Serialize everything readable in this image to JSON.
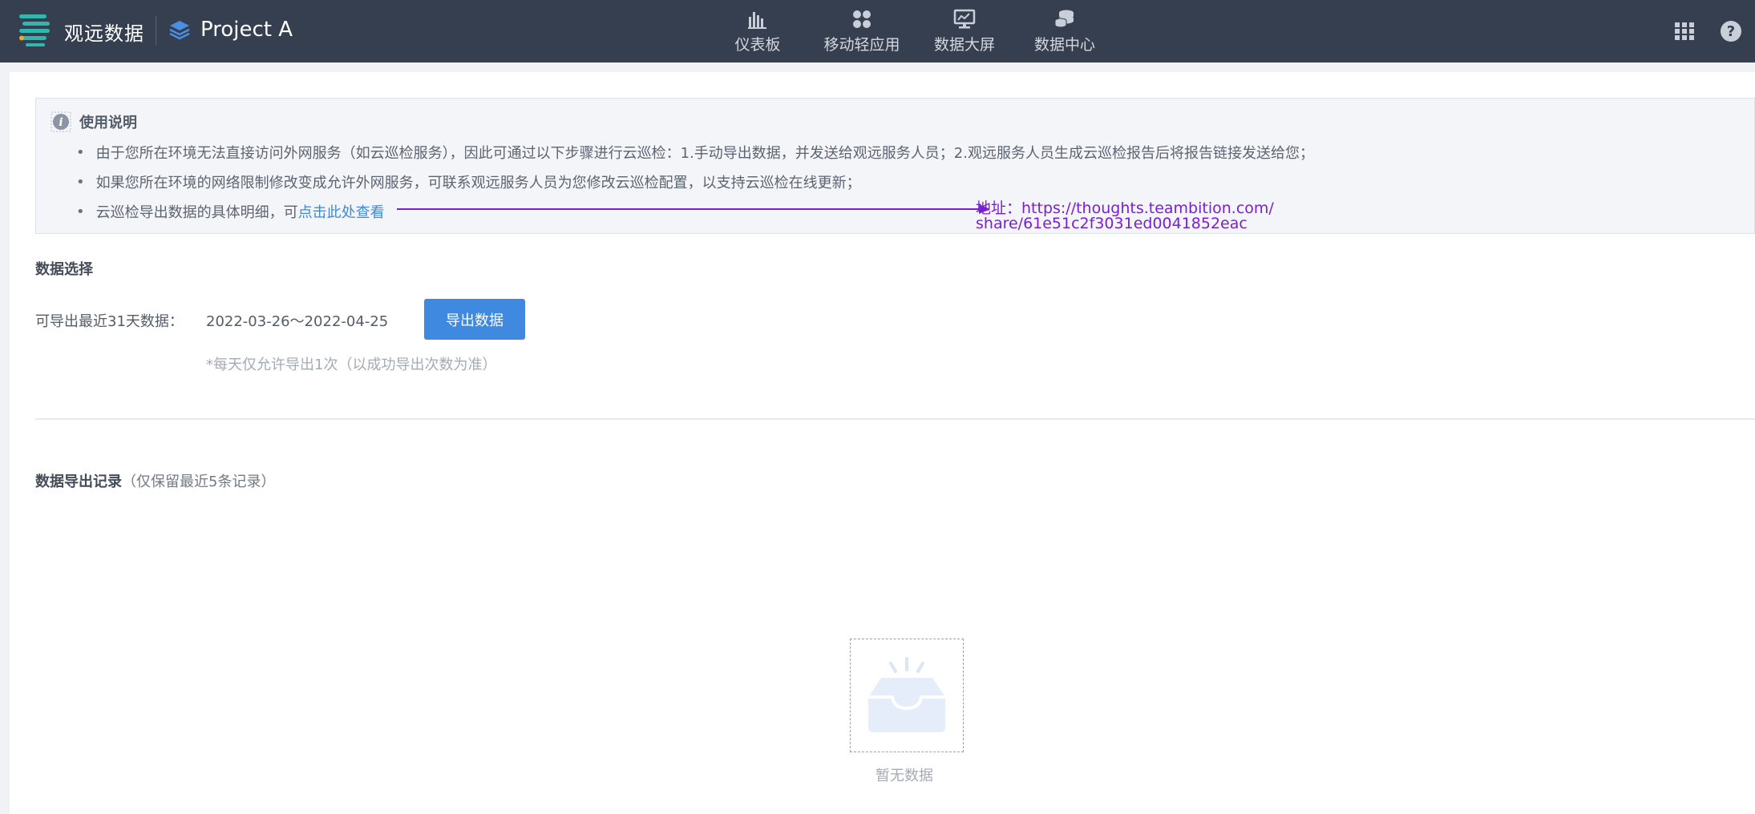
{
  "header": {
    "brand": "观远数据",
    "project": "Project A",
    "nav": [
      {
        "label": "仪表板",
        "icon": "bar-chart-icon"
      },
      {
        "label": "移动轻应用",
        "icon": "app-grid-icon"
      },
      {
        "label": "数据大屏",
        "icon": "monitor-icon"
      },
      {
        "label": "数据中心",
        "icon": "database-icon"
      }
    ],
    "right_icons": [
      "apps-icon",
      "help-icon"
    ]
  },
  "notice": {
    "title": "使用说明",
    "bullets": [
      "由于您所在环境无法直接访问外网服务（如云巡检服务），因此可通过以下步骤进行云巡检：1.手动导出数据，并发送给观远服务人员；2.观远服务人员生成云巡检报告后将报告链接发送给您；",
      "如果您所在环境的网络限制修改变成允许外网服务，可联系观远服务人员为您修改云巡检配置，以支持云巡检在线更新；",
      "云巡检导出数据的具体明细，可"
    ],
    "link_text": "点击此处查看",
    "annotation_line1": "地址：https://thoughts.teambition.com/",
    "annotation_line2": "share/61e51c2f3031ed0041852eac"
  },
  "data_select": {
    "title": "数据选择",
    "label": "可导出最近31天数据：",
    "range": "2022-03-26～2022-04-25",
    "button": "导出数据",
    "hint": "*每天仅允许导出1次（以成功导出次数为准）"
  },
  "records": {
    "title": "数据导出记录",
    "subtitle": "（仅保留最近5条记录）",
    "empty_text": "暂无数据"
  },
  "colors": {
    "topbar": "#353f4f",
    "primary": "#3f8ae0",
    "annotation": "#7a1fd6",
    "logo_teal": "#2fb8b0"
  }
}
